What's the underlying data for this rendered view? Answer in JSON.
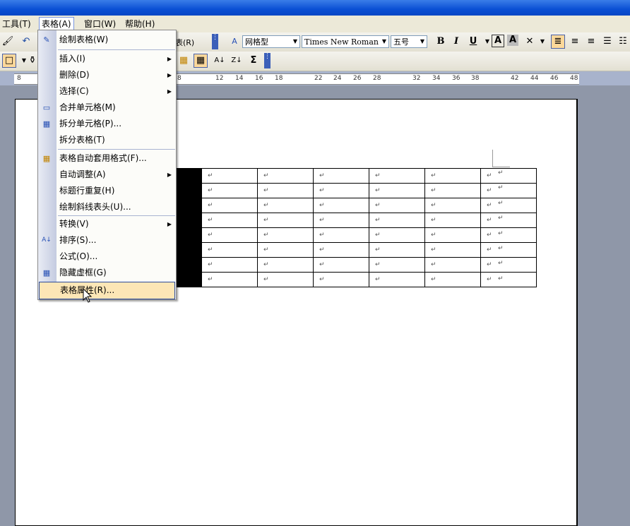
{
  "menubar": {
    "tools": "工具(T)",
    "table": "表格(A)",
    "window": "窗口(W)",
    "help": "帮助(H)"
  },
  "toolbar": {
    "style_fragment": "表(R)",
    "table_style": "网格型",
    "font": "Times New Roman",
    "font_size": "五号",
    "bold": "B",
    "italic": "I",
    "underline": "U",
    "char_border": "A",
    "char_shading": "A",
    "sigma": "Σ"
  },
  "ruler": {
    "numbers": [
      "8",
      "8",
      "12",
      "14",
      "16",
      "18",
      "22",
      "24",
      "26",
      "28",
      "32",
      "34",
      "36",
      "38",
      "42",
      "44",
      "46",
      "48"
    ]
  },
  "table_menu": {
    "draw_table": "绘制表格(W)",
    "insert": "插入(I)",
    "delete": "删除(D)",
    "select": "选择(C)",
    "merge_cells": "合并单元格(M)",
    "split_cells": "拆分单元格(P)...",
    "split_table": "拆分表格(T)",
    "autoformat": "表格自动套用格式(F)...",
    "autofit": "自动调整(A)",
    "heading_rows": "标题行重复(H)",
    "draw_diagonal": "绘制斜线表头(U)...",
    "convert": "转换(V)",
    "sort": "排序(S)...",
    "formula": "公式(O)...",
    "hide_gridlines": "隐藏虚框(G)",
    "table_properties": "表格属性(R)..."
  },
  "document": {
    "cell_mark": "↵"
  },
  "colors": {
    "title_blue": "#0a4fd4",
    "menu_highlight": "#fce6b6",
    "menu_border": "#2c4b9b"
  }
}
